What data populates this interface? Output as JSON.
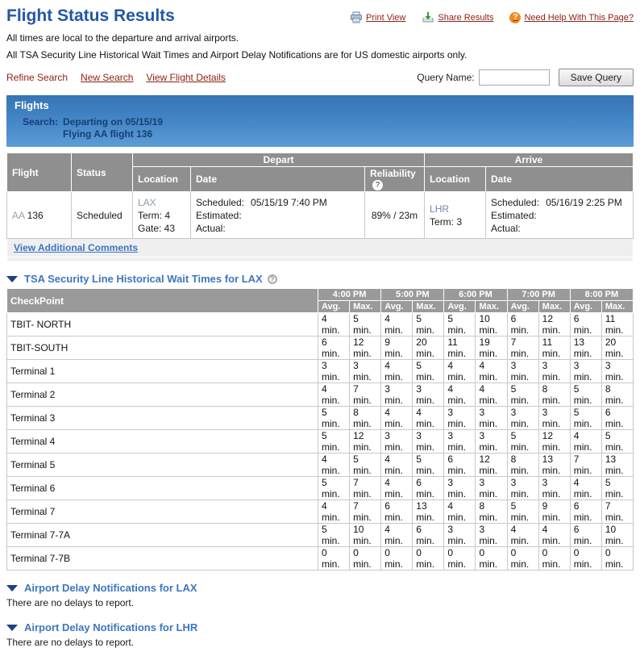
{
  "page": {
    "title": "Flight Status Results",
    "note1": "All times are local to the departure and arrival airports.",
    "note2": "All TSA Security Line Historical Wait Times and Airport Delay Notifications are for US domestic airports only."
  },
  "header_links": {
    "print": "Print View",
    "share": "Share Results",
    "help": "Need Help With This Page?"
  },
  "toolbar": {
    "refine": "Refine Search",
    "new_search": "New Search",
    "view_details": "View Flight Details",
    "query_label": "Query Name:",
    "save_button": "Save Query"
  },
  "flights_panel": {
    "title": "Flights",
    "search_label": "Search:",
    "search_line1": "Departing on 05/15/19",
    "search_line2": "Flying AA flight 136"
  },
  "flight_table": {
    "headers": {
      "flight": "Flight",
      "status": "Status",
      "depart": "Depart",
      "arrive": "Arrive",
      "location": "Location",
      "date": "Date",
      "reliability": "Reliability"
    },
    "row": {
      "airline": "AA",
      "number": "136",
      "status": "Scheduled",
      "depart": {
        "code": "LAX",
        "term": "Term: 4",
        "gate": "Gate: 43",
        "scheduled_label": "Scheduled:",
        "scheduled": "05/15/19 7:40 PM",
        "estimated_label": "Estimated:",
        "actual_label": "Actual:"
      },
      "reliability": "89% / 23m",
      "arrive": {
        "code": "LHR",
        "term": "Term: 3",
        "scheduled_label": "Scheduled:",
        "scheduled": "05/16/19 2:25 PM",
        "estimated_label": "Estimated:",
        "actual_label": "Actual:"
      }
    },
    "comments_link": "View Additional Comments"
  },
  "tsa": {
    "section_title": "TSA Security Line Historical Wait Times for LAX",
    "checkpoint_header": "CheckPoint",
    "times": [
      "4:00 PM",
      "5:00 PM",
      "6:00 PM",
      "7:00 PM",
      "8:00 PM"
    ],
    "avg_label": "Avg.",
    "max_label": "Max.",
    "rows": [
      {
        "name": "TBIT- NORTH",
        "values": [
          "4 min.",
          "5 min.",
          "4 min.",
          "5 min.",
          "5 min.",
          "10 min.",
          "6 min.",
          "12 min.",
          "6 min.",
          "11 min."
        ]
      },
      {
        "name": "TBIT-SOUTH",
        "values": [
          "6 min.",
          "12 min.",
          "9 min.",
          "20 min.",
          "11 min.",
          "19 min.",
          "7 min.",
          "11 min.",
          "13 min.",
          "20 min."
        ]
      },
      {
        "name": "Terminal 1",
        "values": [
          "3 min.",
          "3 min.",
          "4 min.",
          "5 min.",
          "4 min.",
          "4 min.",
          "3 min.",
          "3 min.",
          "3 min.",
          "3 min."
        ]
      },
      {
        "name": "Terminal 2",
        "values": [
          "4 min.",
          "7 min.",
          "3 min.",
          "3 min.",
          "4 min.",
          "4 min.",
          "5 min.",
          "8 min.",
          "5 min.",
          "8 min."
        ]
      },
      {
        "name": "Terminal 3",
        "values": [
          "5 min.",
          "8 min.",
          "4 min.",
          "4 min.",
          "3 min.",
          "3 min.",
          "3 min.",
          "3 min.",
          "5 min.",
          "6 min."
        ]
      },
      {
        "name": "Terminal 4",
        "values": [
          "5 min.",
          "12 min.",
          "3 min.",
          "3 min.",
          "3 min.",
          "3 min.",
          "5 min.",
          "12 min.",
          "4 min.",
          "5 min."
        ]
      },
      {
        "name": "Terminal 5",
        "values": [
          "4 min.",
          "5 min.",
          "4 min.",
          "5 min.",
          "6 min.",
          "12 min.",
          "8 min.",
          "13 min.",
          "7 min.",
          "13 min."
        ]
      },
      {
        "name": "Terminal 6",
        "values": [
          "5 min.",
          "7 min.",
          "4 min.",
          "6 min.",
          "3 min.",
          "3 min.",
          "3 min.",
          "3 min.",
          "4 min.",
          "5 min."
        ]
      },
      {
        "name": "Terminal 7",
        "values": [
          "4 min.",
          "7 min.",
          "6 min.",
          "13 min.",
          "4 min.",
          "8 min.",
          "5 min.",
          "9 min.",
          "6 min.",
          "7 min."
        ]
      },
      {
        "name": "Terminal 7-7A",
        "values": [
          "5 min.",
          "10 min.",
          "4 min.",
          "6 min.",
          "3 min.",
          "3 min.",
          "4 min.",
          "4 min.",
          "6 min.",
          "10 min."
        ]
      },
      {
        "name": "Terminal 7-7B",
        "values": [
          "0 min.",
          "0 min.",
          "0 min.",
          "0 min.",
          "0 min.",
          "0 min.",
          "0 min.",
          "0 min.",
          "0 min.",
          "0 min."
        ]
      }
    ]
  },
  "delays": [
    {
      "title": "Airport Delay Notifications for LAX",
      "message": "There are no delays to report."
    },
    {
      "title": "Airport Delay Notifications for LHR",
      "message": "There are no delays to report."
    }
  ],
  "colors": {
    "accent_blue": "#3d76c0",
    "title_blue": "#2257a5",
    "link_red": "#8b2316",
    "header_gray": "#8f8f8f",
    "panel_blue_top": "#3674b5",
    "panel_blue_bottom": "#5c9dd6"
  }
}
